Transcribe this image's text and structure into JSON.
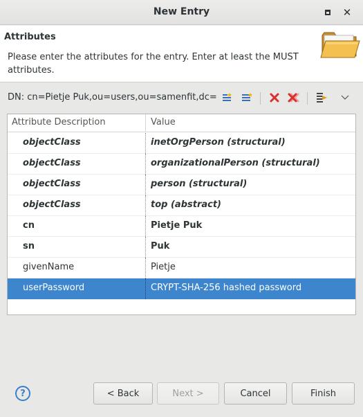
{
  "window": {
    "title": "New Entry"
  },
  "banner": {
    "heading": "Attributes",
    "description": "Please enter the attributes for the entry. Enter at least the MUST attributes.",
    "icon": "folder-icon"
  },
  "dn": {
    "text": "DN: cn=Pietje Puk,ou=users,ou=samenfit,dc="
  },
  "toolbar": {
    "icons": [
      "new-attribute-icon",
      "new-value-icon",
      "delete-icon",
      "delete-all-icon",
      "edit-icon",
      "view-menu-icon"
    ],
    "accent": "#d9302b"
  },
  "table": {
    "headers": [
      "Attribute Description",
      "Value"
    ],
    "rows": [
      {
        "attribute": "objectClass",
        "value": "inetOrgPerson (structural)"
      },
      {
        "attribute": "objectClass",
        "value": "organizationalPerson (structural)"
      },
      {
        "attribute": "objectClass",
        "value": "person (structural)"
      },
      {
        "attribute": "objectClass",
        "value": "top (abstract)"
      },
      {
        "attribute": "cn",
        "value": "Pietje Puk"
      },
      {
        "attribute": "sn",
        "value": "Puk"
      },
      {
        "attribute": "givenName",
        "value": "Pietje"
      },
      {
        "attribute": "userPassword",
        "value": "CRYPT-SHA-256 hashed password"
      }
    ],
    "selected_color": "#3d85cc"
  },
  "buttons": {
    "help": "?",
    "back": "< Back",
    "next": "Next >",
    "cancel": "Cancel",
    "finish": "Finish"
  }
}
